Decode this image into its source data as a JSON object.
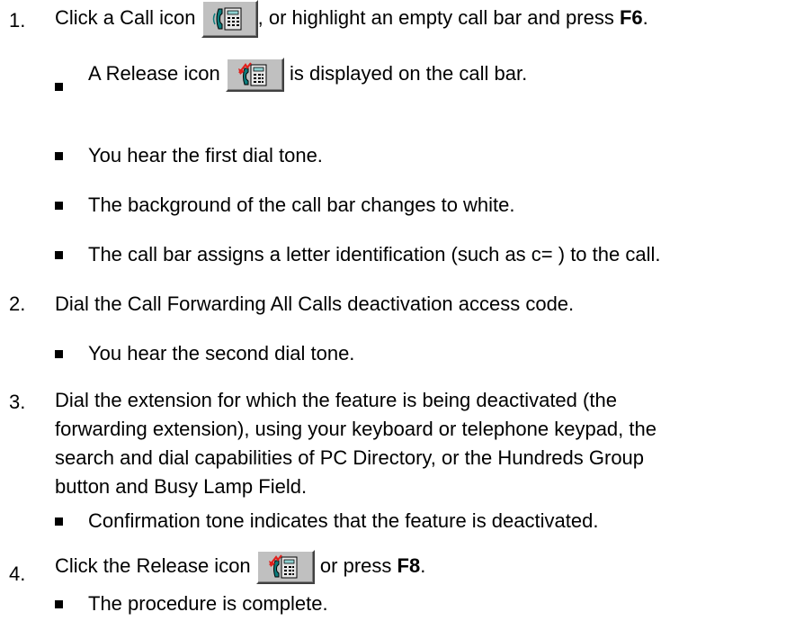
{
  "steps": [
    {
      "number": "1.",
      "text_before": "Click a Call icon",
      "icon": "call-icon",
      "text_after": ", or highlight an empty call bar and press ",
      "key": "F6",
      "end": ".",
      "bullets": [
        {
          "text_before": "A Release icon",
          "icon": "release-icon",
          "text_after": "is displayed on the call bar."
        },
        {
          "text": "You hear the first dial tone."
        },
        {
          "text": "The background of the call bar changes to white."
        },
        {
          "text": "The call bar assigns a letter identification (such as c= ) to the call."
        }
      ]
    },
    {
      "number": "2.",
      "text": "Dial the Call Forwarding All Calls deactivation access code.",
      "bullets": [
        {
          "text": "You hear the second dial tone."
        }
      ]
    },
    {
      "number": "3.",
      "text": "Dial the extension for which the feature is being deactivated (the forwarding extension), using your keyboard or telephone keypad, the search and dial capabilities of PC Directory, or the Hundreds Group button and Busy Lamp Field.",
      "bullets": [
        {
          "text": "Confirmation tone indicates that the feature is deactivated."
        }
      ]
    },
    {
      "number": "4.",
      "text_before": "Click the Release icon",
      "icon": "release-icon",
      "text_after": "or press ",
      "key": "F8",
      "end": ".",
      "bullets": [
        {
          "text": "The procedure is complete."
        }
      ]
    }
  ],
  "colors": {
    "text": "#000000",
    "icon_face": "#c0c0c0",
    "icon_handset": "#0b7c7c",
    "icon_arrow": "#e0201c"
  }
}
